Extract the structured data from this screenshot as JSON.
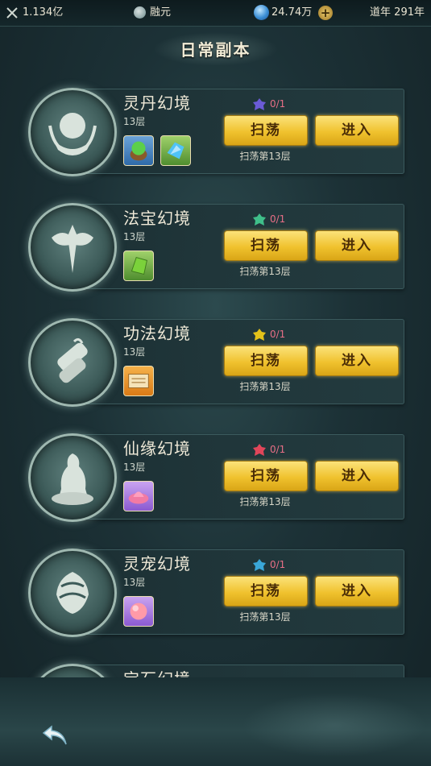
{
  "topbar": {
    "power": "1.134亿",
    "realm": "融元",
    "money": "24.74万",
    "add_symbol": "+",
    "year_label": "道年",
    "year_value": "291年"
  },
  "page_title": "日常副本",
  "sweep_label": "扫荡",
  "enter_label": "进入",
  "dungeons": [
    {
      "name": "灵丹幻境",
      "floor": "13层",
      "count": "0/1",
      "sweep_note": "扫荡第13层",
      "ticket_color": "#6b5bd6",
      "items": [
        "green-pill-cauldron-icon",
        "blue-crystal-icon"
      ]
    },
    {
      "name": "法宝幻境",
      "floor": "13层",
      "count": "0/1",
      "sweep_note": "扫荡第13层",
      "ticket_color": "#3fbf8a",
      "items": [
        "green-jade-shard-icon"
      ]
    },
    {
      "name": "功法幻境",
      "floor": "13层",
      "count": "0/1",
      "sweep_note": "扫荡第13层",
      "ticket_color": "#e3c21a",
      "items": [
        "scroll-manual-icon"
      ]
    },
    {
      "name": "仙缘幻境",
      "floor": "13层",
      "count": "0/1",
      "sweep_note": "扫荡第13层",
      "ticket_color": "#e0465a",
      "items": [
        "pink-lotus-icon"
      ]
    },
    {
      "name": "灵宠幻境",
      "floor": "13层",
      "count": "0/1",
      "sweep_note": "扫荡第13层",
      "ticket_color": "#3aa7d8",
      "items": [
        "pink-gem-icon"
      ]
    },
    {
      "name": "宝石幻境",
      "floor": "",
      "count": "",
      "sweep_note": "",
      "ticket_color": "",
      "items": []
    }
  ],
  "icons": {
    "power": "crossed-swords-icon",
    "realm": "realm-orb-icon",
    "money": "spirit-stone-icon",
    "back": "back-arrow-icon"
  }
}
